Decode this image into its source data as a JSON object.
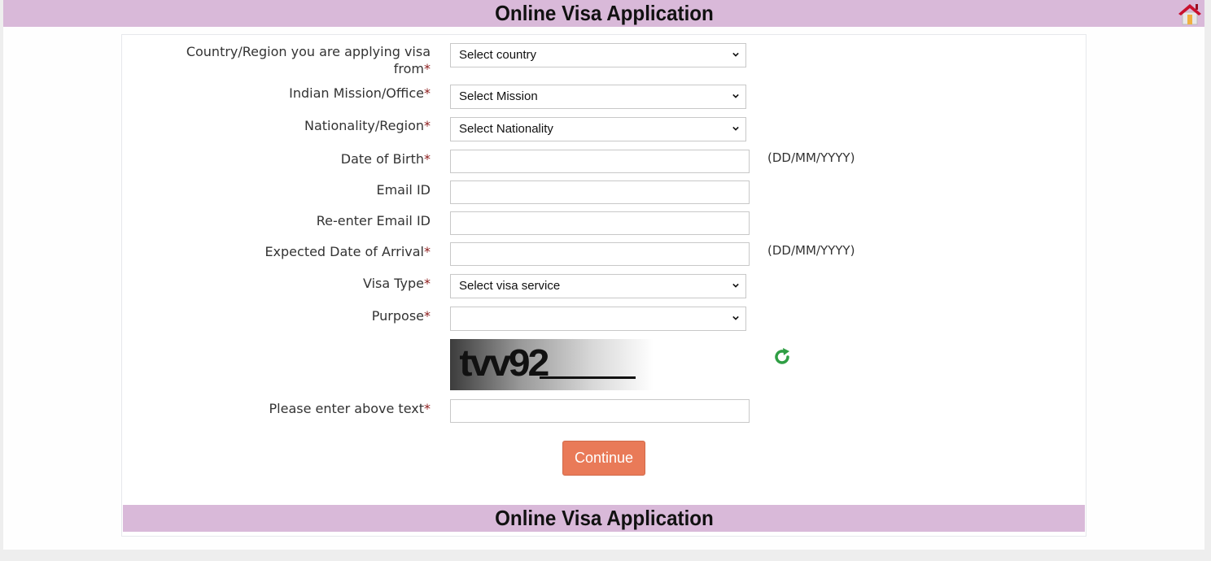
{
  "header": {
    "title": "Online Visa Application",
    "home_icon": "home-icon"
  },
  "form": {
    "required_marker": "*",
    "fields": {
      "country": {
        "label": "Country/Region you are applying visa from",
        "selected": "Select country"
      },
      "mission": {
        "label": "Indian Mission/Office",
        "selected": "Select Mission"
      },
      "nationality": {
        "label": "Nationality/Region",
        "selected": "Select Nationality"
      },
      "dob": {
        "label": "Date of Birth",
        "value": "",
        "hint": "(DD/MM/YYYY)"
      },
      "email": {
        "label": "Email ID",
        "value": ""
      },
      "email_confirm": {
        "label": "Re-enter Email ID",
        "value": ""
      },
      "arrival": {
        "label": "Expected Date of Arrival",
        "value": "",
        "hint": "(DD/MM/YYYY)"
      },
      "visa_type": {
        "label": "Visa Type",
        "selected": "Select visa service"
      },
      "purpose": {
        "label": "Purpose",
        "selected": ""
      },
      "captcha": {
        "image_text": "tvv92",
        "refresh_icon": "refresh-icon"
      },
      "captcha_input": {
        "label": "Please enter above text",
        "value": ""
      }
    },
    "continue_label": "Continue"
  },
  "footer": {
    "title": "Online Visa Application"
  },
  "colors": {
    "header_bg": "#d9b9d9",
    "button_bg": "#e97a58",
    "required": "#8b1a1a",
    "refresh": "#2f9e44"
  }
}
